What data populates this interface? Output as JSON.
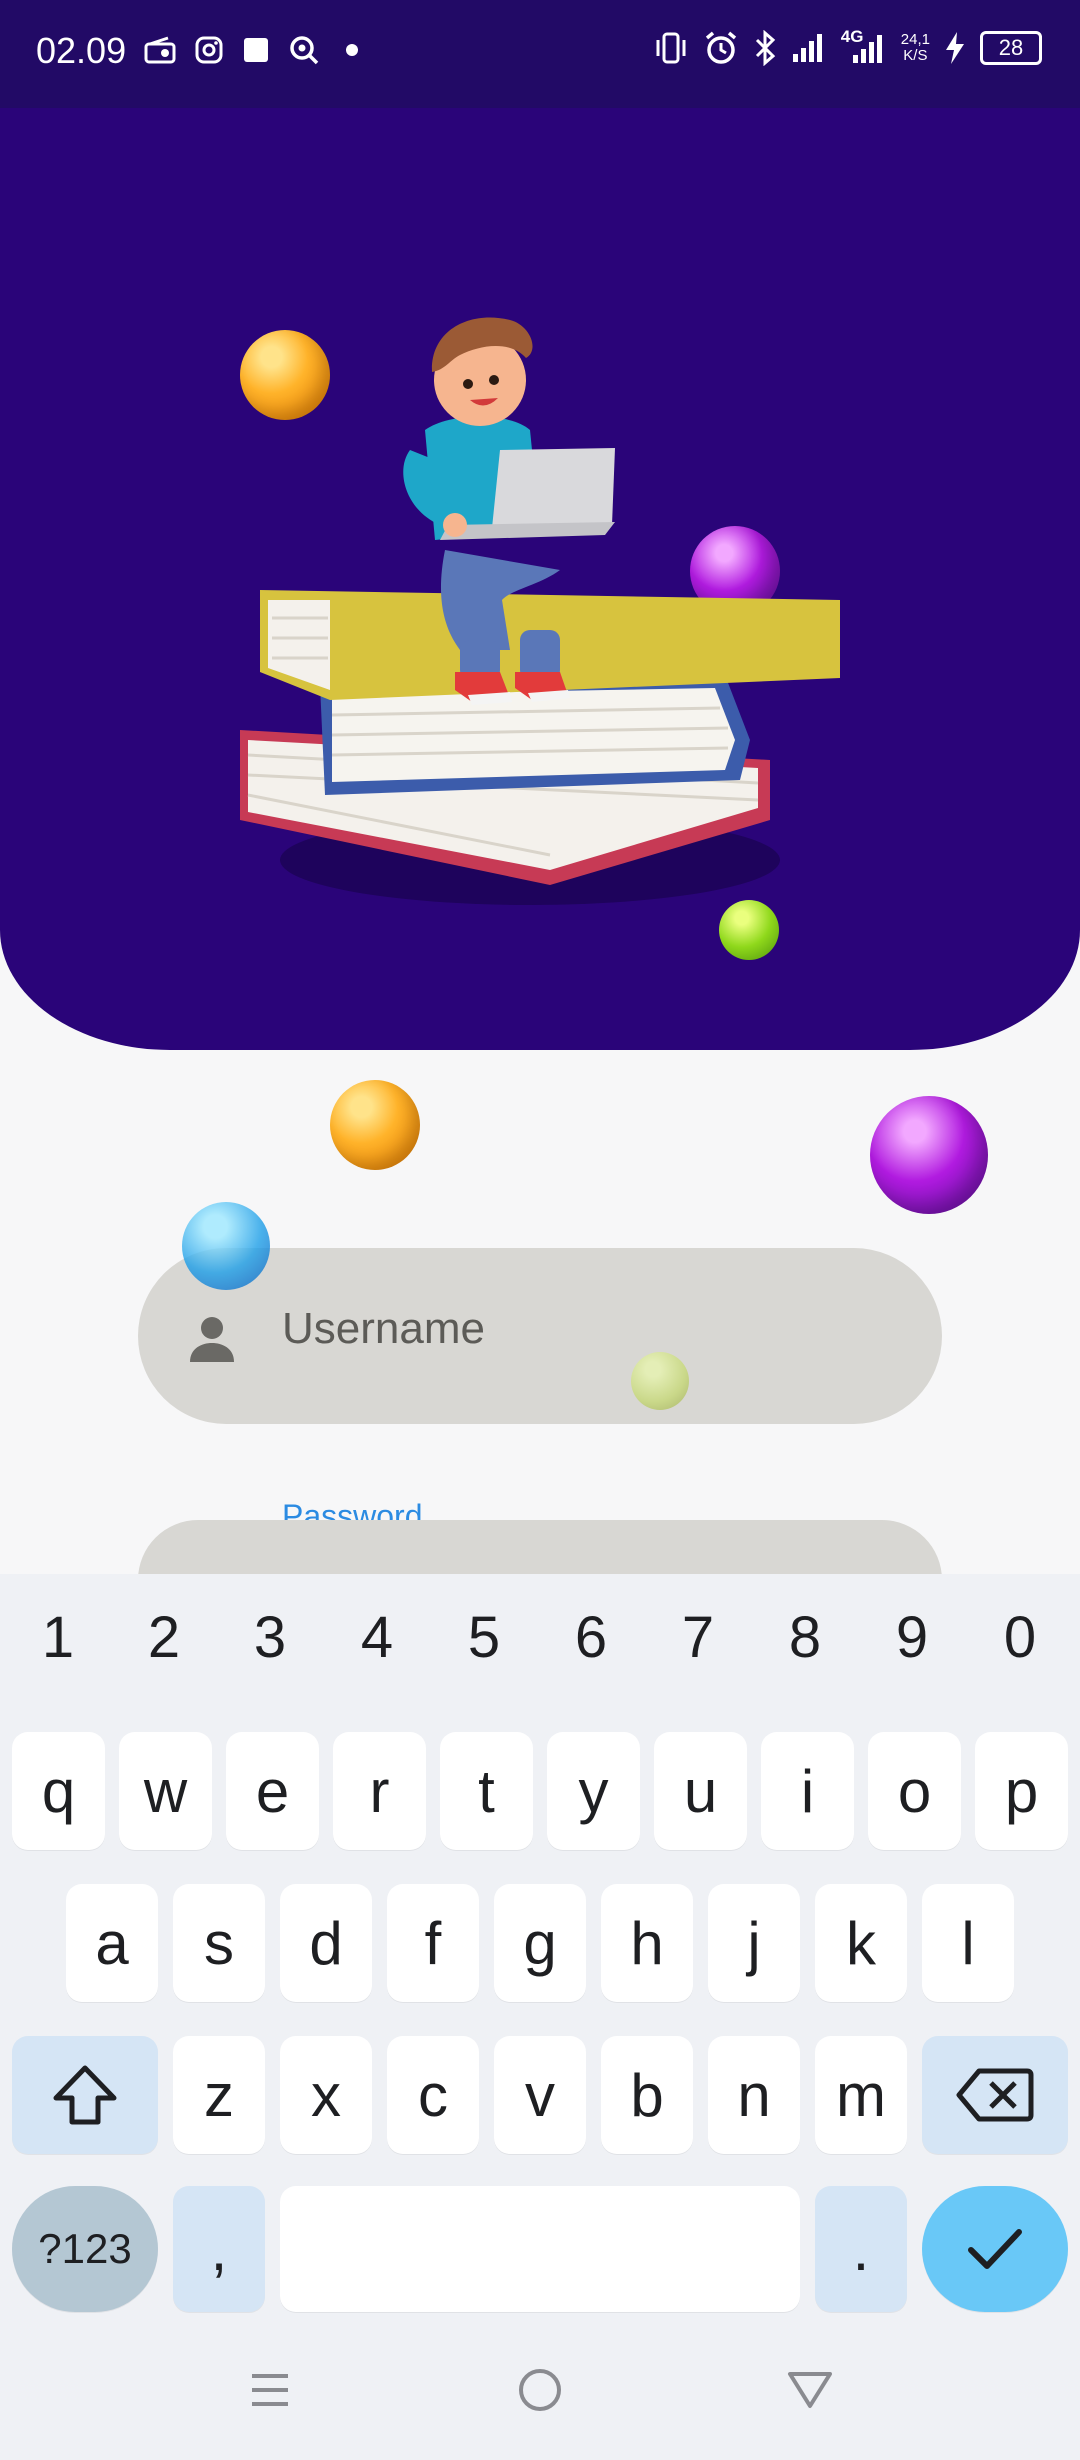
{
  "status_bar": {
    "time": "02.09",
    "network_label": "4G",
    "speed_value": "24,1",
    "speed_unit": "K/S",
    "battery": "28",
    "left_icons": [
      "radio-icon",
      "instagram-icon",
      "square-icon",
      "search-notification-icon",
      "dot-icon"
    ],
    "right_icons": [
      "vibrate-icon",
      "alarm-icon",
      "bluetooth-icon",
      "signal-icon",
      "signal-4g-icon",
      "charging-icon",
      "battery-icon"
    ]
  },
  "login": {
    "username_placeholder": "Username",
    "password_label": "Password"
  },
  "keyboard": {
    "number_row": [
      "1",
      "2",
      "3",
      "4",
      "5",
      "6",
      "7",
      "8",
      "9",
      "0"
    ],
    "row1": [
      "q",
      "w",
      "e",
      "r",
      "t",
      "y",
      "u",
      "i",
      "o",
      "p"
    ],
    "row2": [
      "a",
      "s",
      "d",
      "f",
      "g",
      "h",
      "j",
      "k",
      "l"
    ],
    "row3": [
      "z",
      "x",
      "c",
      "v",
      "b",
      "n",
      "m"
    ],
    "symbols_key": "?123",
    "comma_key": ",",
    "period_key": ".",
    "icons": [
      "shift-icon",
      "backspace-icon",
      "checkmark-icon"
    ]
  },
  "navigation": {
    "icons": [
      "menu-icon",
      "home-icon",
      "back-icon"
    ]
  },
  "colors": {
    "hero_background": "#2a0479",
    "status_background": "#220a66",
    "field_background": "#d8d7d3",
    "accent_blue": "#2b8be2",
    "confirm_key": "#69c8f7"
  }
}
